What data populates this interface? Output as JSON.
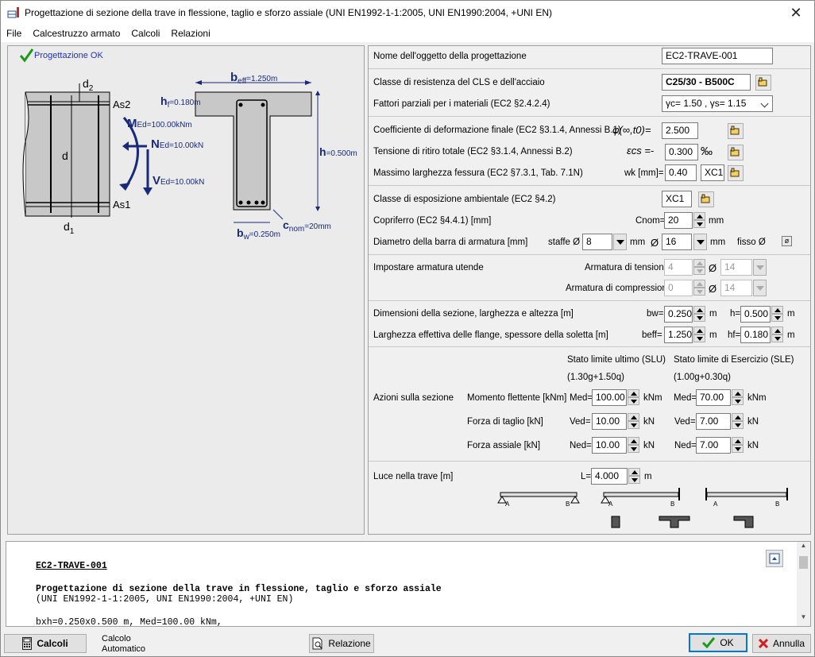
{
  "window": {
    "title": "Progettazione di sezione della trave in flessione, taglio e sforzo assiale (UNI EN1992-1-1:2005, UNI EN1990:2004, +UNI EN)",
    "close": "✕"
  },
  "menu": [
    "File",
    "Calcestruzzo armato",
    "Calcoli",
    "Relazioni"
  ],
  "drawing": {
    "status": "Progettazione OK",
    "d2": "d",
    "d2_sub": "2",
    "d": "d",
    "d1": "d",
    "d1_sub": "1",
    "as2": "As2",
    "as1": "As1",
    "med_M": "M",
    "med_sub": "Ed",
    "med_val": "=100.00kNm",
    "ned_N": "N",
    "ned_sub": "Ed",
    "ned_val": "=10.00kN",
    "ved_V": "V",
    "ved_sub": "Ed",
    "ved_val": "=10.00kN",
    "beff_b": "b",
    "beff_sub": "eff",
    "beff_val": "=1.250m",
    "hf_h": "h",
    "hf_sub": "f",
    "hf_val": "=0.180m",
    "h_h": "h",
    "h_val": "=0.500m",
    "bw_b": "b",
    "bw_sub": "w",
    "bw_val": "=0.250m",
    "cnom_c": "c",
    "cnom_sub": "nom",
    "cnom_val": "=20mm"
  },
  "form": {
    "name_label": "Nome dell'oggetto della progettazione",
    "name_value": "EC2-TRAVE-001",
    "class_label": "Classe di resistenza del CLS e dell'acciaio",
    "class_value": "C25/30 - B500C",
    "factors_label": "Fattori parziali per i materiali (EC2 §2.4.2.4)",
    "factors_value": "γc= 1.50 , γs= 1.15",
    "creep_label": "Coefficiente di deformazione finale (EC2 §3.1.4, Annessi B.1)",
    "creep_symbol": "φ(∞,t0)=",
    "creep_value": "2.500",
    "shrink_label": "Tensione di ritiro totale (EC2 §3.1.4, Annessi B.2)",
    "shrink_symbol": "εcs =-",
    "shrink_value": "0.300",
    "shrink_unit": "‰",
    "crack_label": "Massimo larghezza fessura (EC2 §7.3.1, Tab. 7.1N)",
    "crack_symbol": "wk [mm]=",
    "crack_value": "0.40",
    "crack_class": "XC1",
    "exposure_label": "Classe di esposizione ambientale (EC2 §4.2)",
    "exposure_value": "XC1",
    "cover_label": "Copriferro (EC2 §4.4.1) [mm]",
    "cover_symbol": "Cnom=",
    "cover_value": "20",
    "cover_unit": "mm",
    "dia_label": "Diametro della barra di armatura [mm]",
    "stirrups_label": "staffe Ø",
    "stirrups_value": "8",
    "stirrups_unit": "mm",
    "bar_symbol": "Ø",
    "bar_value": "16",
    "bar_unit": "mm",
    "fixed_label": "fisso Ø",
    "user_label": "Impostare armatura utende",
    "tension_label": "Armatura di tensione",
    "tension_n": "4",
    "tension_phi": "Ø",
    "tension_d": "14",
    "comp_label": "Armatura di compressione",
    "comp_n": "0",
    "comp_phi": "Ø",
    "comp_d": "14",
    "dims_label": "Dimensioni della sezione, larghezza e altezza [m]",
    "bw_sym": "bw=",
    "bw_value": "0.250",
    "bw_unit": "m",
    "h_sym": "h=",
    "h_value": "0.500",
    "h_unit": "m",
    "flange_label": "Larghezza effettiva delle flange, spessore della soletta [m]",
    "beff_sym": "beff=",
    "beff_value": "1.250",
    "beff_unit": "m",
    "hf_sym": "hf=",
    "hf_value": "0.180",
    "hf_unit": "m",
    "slu_title": "Stato limite ultimo (SLU)",
    "slu_comb": "(1.30g+1.50q)",
    "sle_title": "Stato limite di Esercizio (SLE)",
    "sle_comb": "(1.00g+0.30q)",
    "actions_label": "Azioni sulla sezione",
    "moment_label": "Momento flettente [kNm]",
    "med_sym": "Med=",
    "med_slu": "100.00",
    "med_unit": "kNm",
    "med_sle": "70.00",
    "shear_label": "Forza di taglio [kN]",
    "ved_sym": "Ved=",
    "ved_slu": "10.00",
    "ved_unit": "kN",
    "ved_sle": "7.00",
    "axial_label": "Forza assiale [kN]",
    "ned_sym": "Ned=",
    "ned_slu": "10.00",
    "ned_unit": "kN",
    "ned_sle": "7.00",
    "span_label": "Luce nella trave [m]",
    "span_sym": "L=",
    "span_value": "4.000",
    "span_unit": "m",
    "beam_a": "A",
    "beam_b": "B"
  },
  "report": {
    "l1": "EC2-TRAVE-001",
    "l2": "Progettazione di sezione della trave in flessione, taglio e sforzo assiale",
    "l3": "(UNI EN1992-1-1:2005, UNI EN1990:2004, +UNI EN)",
    "l4": "bxh=0.250x0.500 m, Med=100.00 kNm,"
  },
  "footer": {
    "calc": "Calcoli",
    "auto1": "Calcolo",
    "auto2": "Automatico",
    "report": "Relazione",
    "ok": "OK",
    "cancel": "Annulla"
  }
}
